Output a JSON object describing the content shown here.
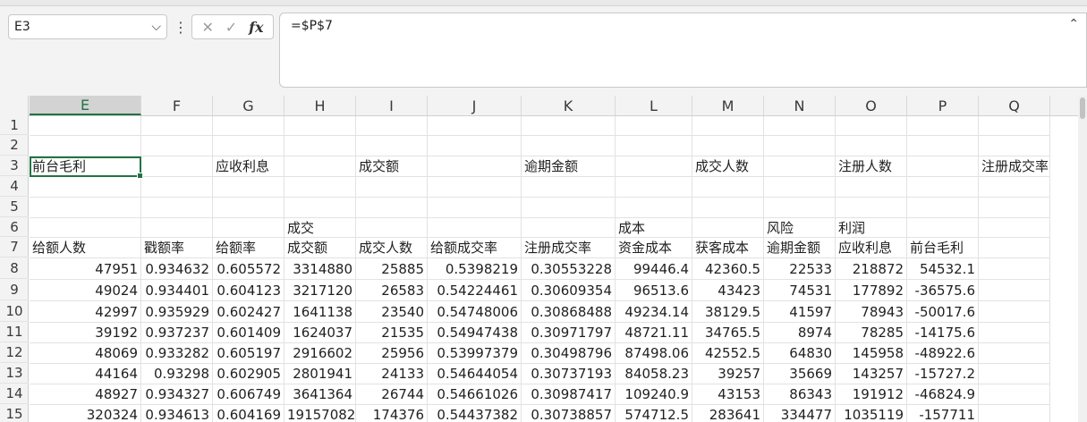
{
  "namebox": {
    "value": "E3"
  },
  "formula": {
    "value": "=$P$7"
  },
  "columns": [
    "E",
    "F",
    "G",
    "H",
    "I",
    "J",
    "K",
    "L",
    "M",
    "N",
    "O",
    "P",
    "Q"
  ],
  "rows": [
    "1",
    "2",
    "3",
    "4",
    "5",
    "6",
    "7",
    "8",
    "9",
    "10",
    "11",
    "12",
    "13",
    "14",
    "15"
  ],
  "cells": [
    [],
    [],
    [
      "前台毛利",
      "",
      "应收利息",
      "",
      "成交额",
      "",
      "逾期金额",
      "",
      "成交人数",
      "",
      "注册人数",
      "",
      "注册成交率"
    ],
    [],
    [],
    [
      "",
      "",
      "",
      "成交",
      "",
      "",
      "",
      "成本",
      "",
      "风险",
      "利润",
      "",
      ""
    ],
    [
      "给额人数",
      "戳额率",
      "给额率",
      "成交额",
      "成交人数",
      "给额成交率",
      "注册成交率",
      "资金成本",
      "获客成本",
      "逾期金额",
      "应收利息",
      "前台毛利",
      ""
    ],
    [
      "47951",
      "0.934632",
      "0.605572",
      "3314880",
      "25885",
      "0.5398219",
      "0.30553228",
      "99446.4",
      "42360.5",
      "22533",
      "218872",
      "54532.1",
      ""
    ],
    [
      "49024",
      "0.934401",
      "0.604123",
      "3217120",
      "26583",
      "0.54224461",
      "0.30609354",
      "96513.6",
      "43423",
      "74531",
      "177892",
      "-36575.6",
      ""
    ],
    [
      "42997",
      "0.935929",
      "0.602427",
      "1641138",
      "23540",
      "0.54748006",
      "0.30868488",
      "49234.14",
      "38129.5",
      "41597",
      "78943",
      "-50017.6",
      ""
    ],
    [
      "39192",
      "0.937237",
      "0.601409",
      "1624037",
      "21535",
      "0.54947438",
      "0.30971797",
      "48721.11",
      "34765.5",
      "8974",
      "78285",
      "-14175.6",
      ""
    ],
    [
      "48069",
      "0.933282",
      "0.605197",
      "2916602",
      "25956",
      "0.53997379",
      "0.30498796",
      "87498.06",
      "42552.5",
      "64830",
      "145958",
      "-48922.6",
      ""
    ],
    [
      "44164",
      "0.93298",
      "0.602905",
      "2801941",
      "24133",
      "0.54644054",
      "0.30737193",
      "84058.23",
      "39257",
      "35669",
      "143257",
      "-15727.2",
      ""
    ],
    [
      "48927",
      "0.934327",
      "0.606749",
      "3641364",
      "26744",
      "0.54661026",
      "0.30987417",
      "109240.9",
      "43153",
      "86343",
      "191912",
      "-46824.9",
      ""
    ],
    [
      "320324",
      "0.934613",
      "0.604169",
      "19157082",
      "174376",
      "0.54437382",
      "0.30738857",
      "574712.5",
      "283641",
      "334477",
      "1035119",
      "-157711",
      ""
    ]
  ]
}
